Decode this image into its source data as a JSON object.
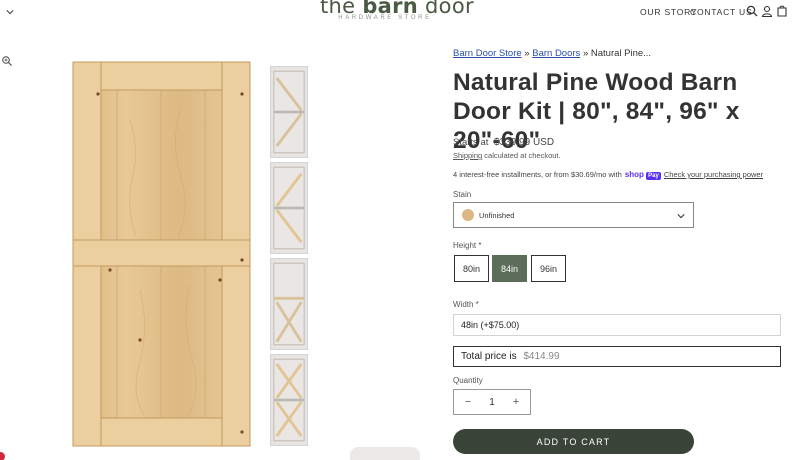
{
  "header": {
    "logo_prefix": "the ",
    "logo_bold": "barn",
    "logo_suffix": " door",
    "logo_sub": "HARDWARE STORE",
    "nav": [
      "OUR STORY",
      "CONTACT US"
    ],
    "icons": [
      "search-icon",
      "account-icon",
      "cart-icon"
    ]
  },
  "gallery": {
    "thumbnails": [
      "z-brace",
      "z-brace-alt",
      "x-brace-double",
      "x-brace-stacked"
    ]
  },
  "breadcrumb": {
    "items": [
      "Barn Door Store",
      "Barn Doors",
      "Natural Pine..."
    ],
    "separator": "»"
  },
  "product": {
    "title": "Natural Pine Wood Barn Door Kit | 80\", 84\", 96\" x 20\"-60\"",
    "starts_at": "Starts at",
    "price": "$339.99 USD",
    "shipping_link": "Shipping",
    "shipping_text": " calculated at checkout.",
    "installments_text": "4 interest-free installments, or from $30.69/mo with",
    "shop": "shop",
    "pay": "Pay",
    "power_link": "Check your purchasing power"
  },
  "options": {
    "stain_label": "Stain",
    "stain_value": "Unfinished",
    "stain_swatch_color": "#dcb886",
    "height_label": "Height *",
    "heights": [
      "80in",
      "84in",
      "96in"
    ],
    "height_selected": "84in",
    "width_label": "Width *",
    "width_value": "48in (+$75.00)"
  },
  "total": {
    "label": "Total price is",
    "amount": "$414.99"
  },
  "quantity": {
    "label": "Quantity",
    "minus": "−",
    "value": "1",
    "plus": "+"
  },
  "cart": {
    "button": "ADD TO CART"
  },
  "colors": {
    "accent_green": "#5c6e59",
    "button_dark": "#3a4438",
    "link_blue": "#2b4fa8",
    "shop_pay": "#5a31f4"
  }
}
